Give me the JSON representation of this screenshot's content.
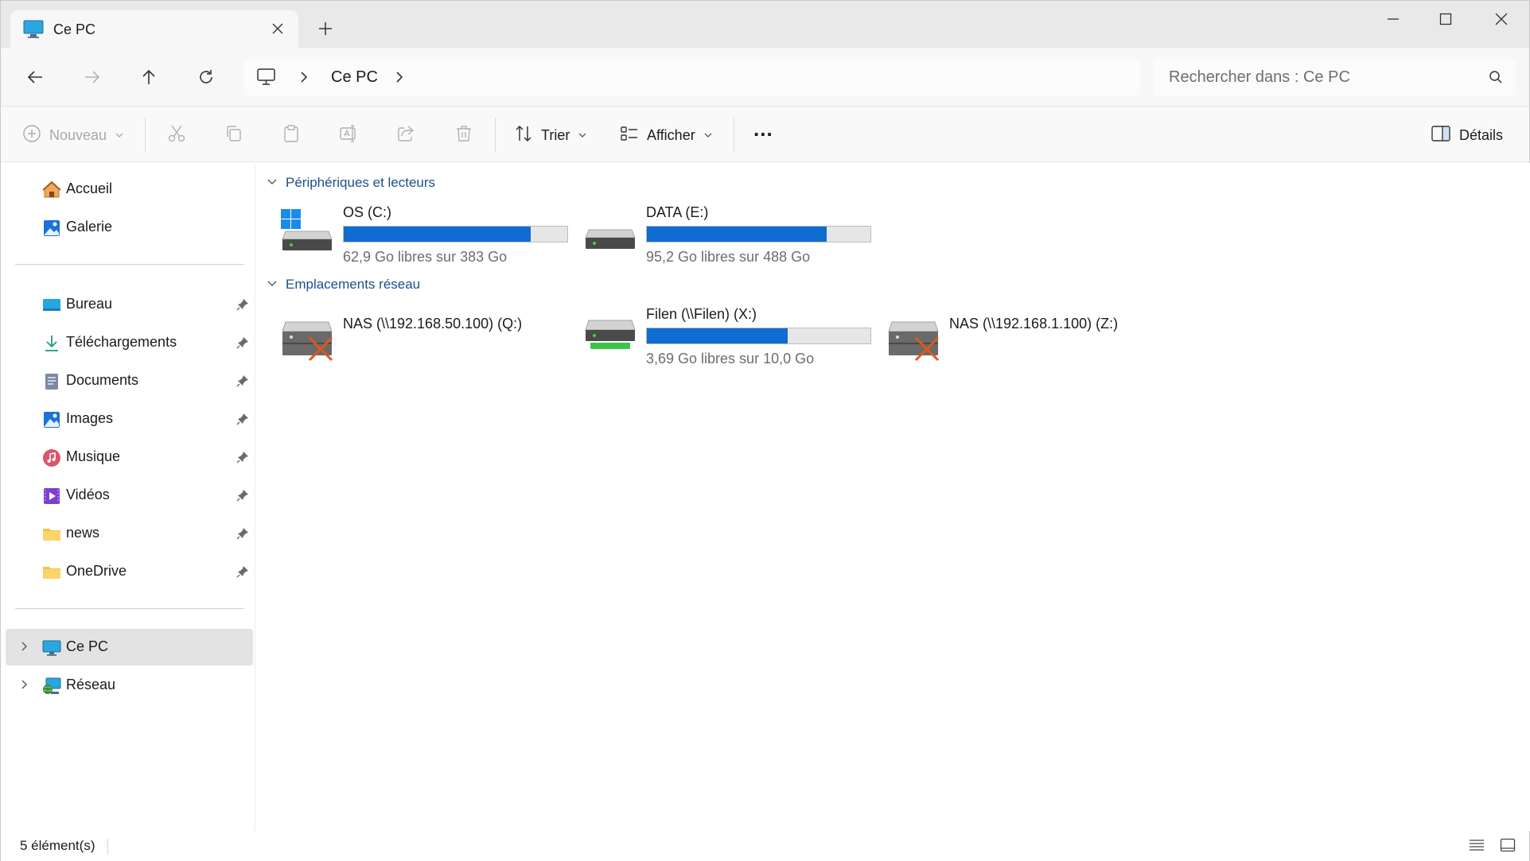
{
  "window": {
    "tab_title": "Ce PC",
    "tab_icon": "pc-monitor-icon"
  },
  "navigation": {
    "breadcrumb": [
      "Ce PC"
    ],
    "search_placeholder": "Rechercher dans : Ce PC"
  },
  "toolbar": {
    "new_label": "Nouveau",
    "sort_label": "Trier",
    "view_label": "Afficher",
    "more_label": "...",
    "details_label": "Détails"
  },
  "sidebar": {
    "quick": [
      {
        "label": "Accueil",
        "icon": "home-icon"
      },
      {
        "label": "Galerie",
        "icon": "gallery-icon"
      }
    ],
    "pinned": [
      {
        "label": "Bureau",
        "icon": "desktop-folder-icon"
      },
      {
        "label": "Téléchargements",
        "icon": "download-icon"
      },
      {
        "label": "Documents",
        "icon": "documents-icon"
      },
      {
        "label": "Images",
        "icon": "pictures-icon"
      },
      {
        "label": "Musique",
        "icon": "music-icon"
      },
      {
        "label": "Vidéos",
        "icon": "videos-icon"
      },
      {
        "label": "news",
        "icon": "folder-icon"
      },
      {
        "label": "OneDrive",
        "icon": "folder-icon"
      }
    ],
    "tree": [
      {
        "label": "Ce PC",
        "icon": "pc-monitor-icon",
        "selected": true
      },
      {
        "label": "Réseau",
        "icon": "network-icon",
        "selected": false
      }
    ]
  },
  "content": {
    "groups": [
      {
        "title": "Périphériques et lecteurs",
        "items": [
          {
            "name": "OS (C:)",
            "space": "62,9 Go libres sur 383 Go",
            "used_fraction": 0.836,
            "icon": "windows-drive-icon"
          },
          {
            "name": "DATA (E:)",
            "space": "95,2 Go libres sur 488 Go",
            "used_fraction": 0.805,
            "icon": "hard-drive-icon"
          }
        ]
      },
      {
        "title": "Emplacements réseau",
        "items": [
          {
            "name": "NAS (\\\\192.168.50.100) (Q:)",
            "space": "",
            "disconnected": true,
            "icon": "disconnected-network-drive-icon"
          },
          {
            "name": "Filen (\\\\Filen) (X:)",
            "space": "3,69 Go libres sur 10,0 Go",
            "used_fraction": 0.631,
            "icon": "network-drive-icon"
          },
          {
            "name": "NAS (\\\\192.168.1.100) (Z:)",
            "space": "",
            "disconnected": true,
            "icon": "disconnected-network-drive-icon"
          }
        ]
      }
    ]
  },
  "status": {
    "count": "5 élément(s)"
  },
  "colors": {
    "accent": "#0f6cd0",
    "group_header": "#1b4f8c",
    "selected_bg": "#e3e3e3"
  }
}
